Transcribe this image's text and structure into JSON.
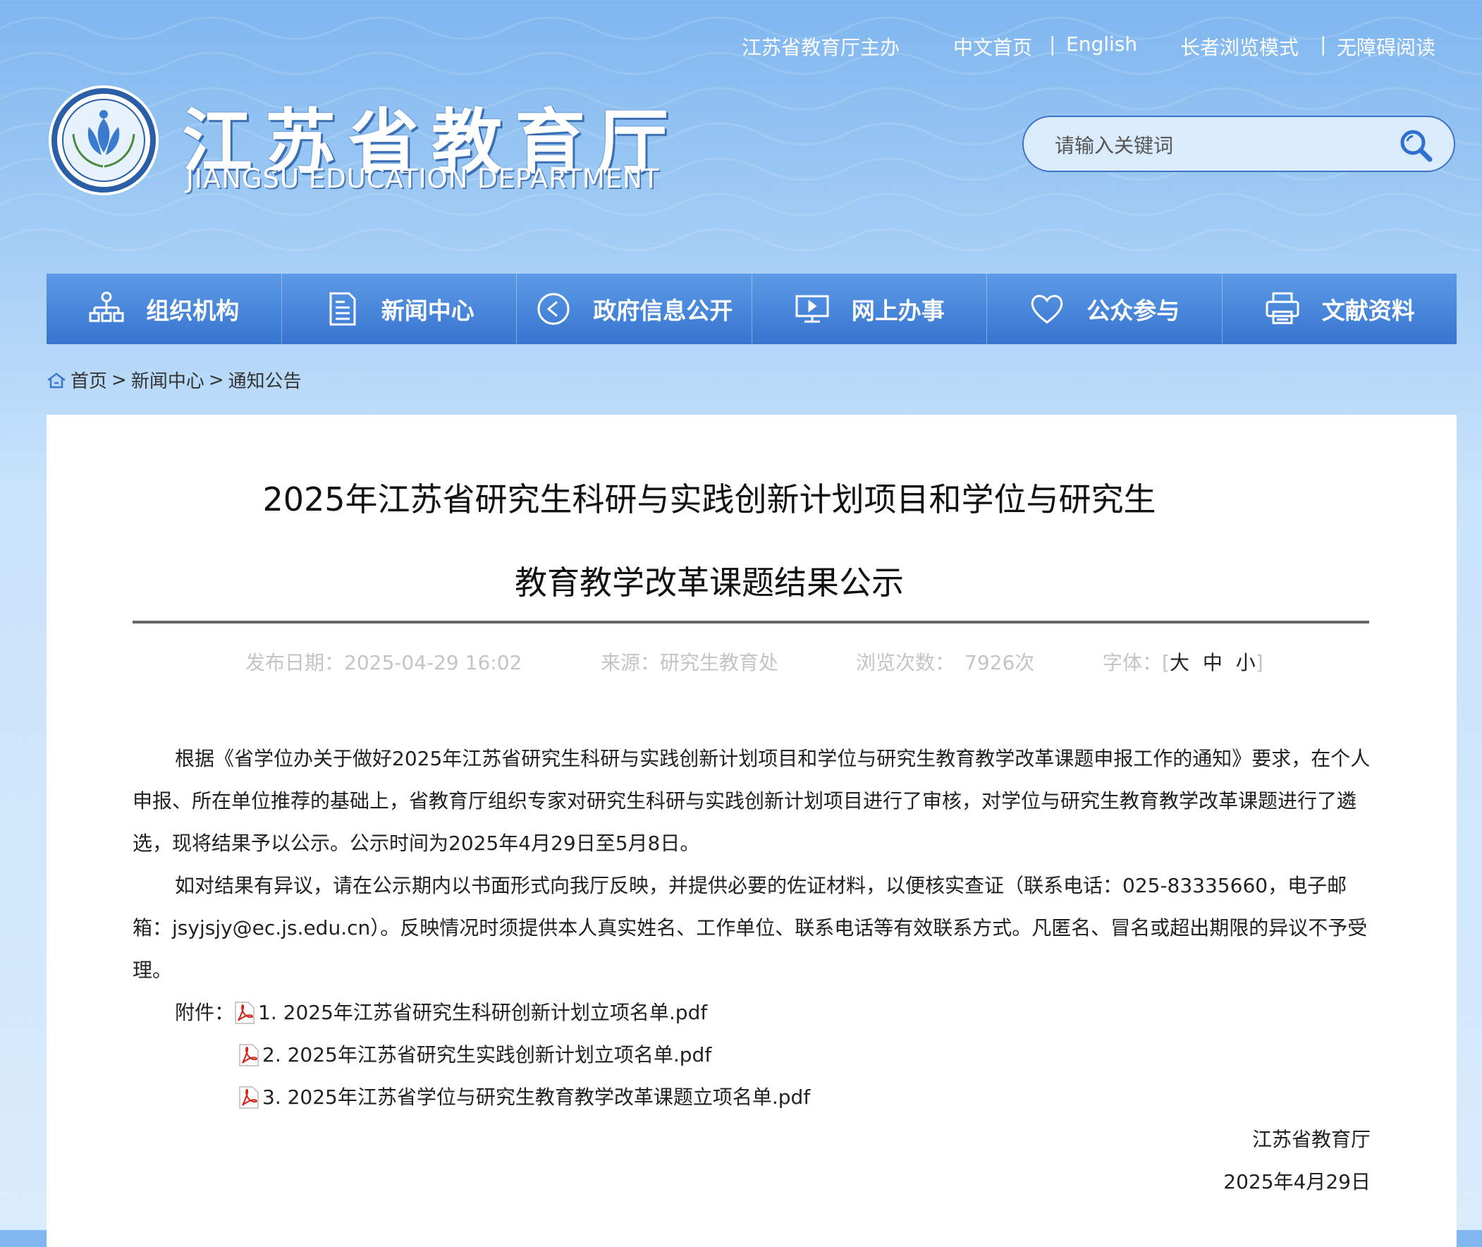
{
  "header": {
    "sponsor": "江苏省教育厅主办",
    "home_cn": "中文首页",
    "english": "English",
    "elder_mode": "长者浏览模式",
    "accessible": "无障碍阅读",
    "brand_cn": "江苏省教育厅",
    "brand_en": "JIANGSU EDUCATION DEPARTMENT",
    "search_placeholder": "请输入关键词"
  },
  "nav": [
    {
      "label": "组织机构",
      "icon": "org-chart-icon"
    },
    {
      "label": "新闻中心",
      "icon": "document-icon"
    },
    {
      "label": "政府信息公开",
      "icon": "play-circle-icon"
    },
    {
      "label": "网上办事",
      "icon": "monitor-icon"
    },
    {
      "label": "公众参与",
      "icon": "heart-icon"
    },
    {
      "label": "文献资料",
      "icon": "printer-icon"
    }
  ],
  "breadcrumb": {
    "home": "首页",
    "sep1": ">",
    "news": "新闻中心",
    "sep2": ">",
    "notice": "通知公告"
  },
  "article": {
    "title_line1": "2025年江苏省研究生科研与实践创新计划项目和学位与研究生",
    "title_line2": "教育教学改革课题结果公示",
    "publish_label": "发布日期：",
    "publish_value": "2025-04-29 16:02",
    "source_label": "来源：",
    "source_value": "研究生教育处",
    "views_label": "浏览次数：",
    "views_value": "7926次",
    "font_label": "字体：",
    "bracket_open": "[",
    "font_large": "大",
    "font_medium": "中",
    "font_small": "小",
    "bracket_close": "]",
    "para1": "根据《省学位办关于做好2025年江苏省研究生科研与实践创新计划项目和学位与研究生教育教学改革课题申报工作的通知》要求，在个人申报、所在单位推荐的基础上，省教育厅组织专家对研究生科研与实践创新计划项目进行了审核，对学位与研究生教育教学改革课题进行了遴选，现将结果予以公示。公示时间为2025年4月29日至5月8日。",
    "para2": "如对结果有异议，请在公示期内以书面形式向我厅反映，并提供必要的佐证材料，以便核实查证（联系电话：025-83335660，电子邮箱：jsyjsjy@ec.js.edu.cn）。反映情况时须提供本人真实姓名、工作单位、联系电话等有效联系方式。凡匿名、冒名或超出期限的异议不予受理。",
    "attachments_label": "附件：",
    "attachments": [
      "1. 2025年江苏省研究生科研创新计划立项名单.pdf",
      "2. 2025年江苏省研究生实践创新计划立项名单.pdf",
      "3. 2025年江苏省学位与研究生教育教学改革课题立项名单.pdf"
    ],
    "signature": "江苏省教育厅",
    "date": "2025年4月29日"
  },
  "colors": {
    "nav_top": "#5c9ae6",
    "nav_bottom": "#3775d0",
    "search_border": "#3d72c4"
  }
}
